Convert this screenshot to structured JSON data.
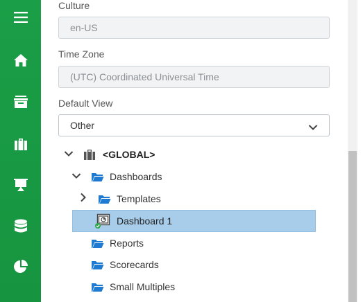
{
  "sidebar": {
    "items": [
      {
        "icon": "menu-icon"
      },
      {
        "icon": "home-icon"
      },
      {
        "icon": "archive-icon"
      },
      {
        "icon": "briefcase-icon"
      },
      {
        "icon": "presentation-icon"
      },
      {
        "icon": "database-icon"
      },
      {
        "icon": "pie-chart-icon"
      }
    ],
    "color": "#1a9e47"
  },
  "form": {
    "culture": {
      "label": "Culture",
      "value": "en-US"
    },
    "timezone": {
      "label": "Time Zone",
      "value": "(UTC) Coordinated Universal Time"
    },
    "default_view": {
      "label": "Default View",
      "selected": "Other"
    }
  },
  "tree": {
    "root": {
      "label": "<GLOBAL>",
      "icon": "briefcase-icon"
    },
    "dashboards": {
      "label": "Dashboards"
    },
    "templates": {
      "label": "Templates"
    },
    "dashboard1": {
      "label": "Dashboard 1",
      "selected": true
    },
    "reports": {
      "label": "Reports"
    },
    "scorecards": {
      "label": "Scorecards"
    },
    "small_multiples": {
      "label": "Small Multiples"
    }
  },
  "colors": {
    "folder": "#1f7ad1",
    "selection": "#a8cdea",
    "status_ok": "#2aa84a"
  }
}
